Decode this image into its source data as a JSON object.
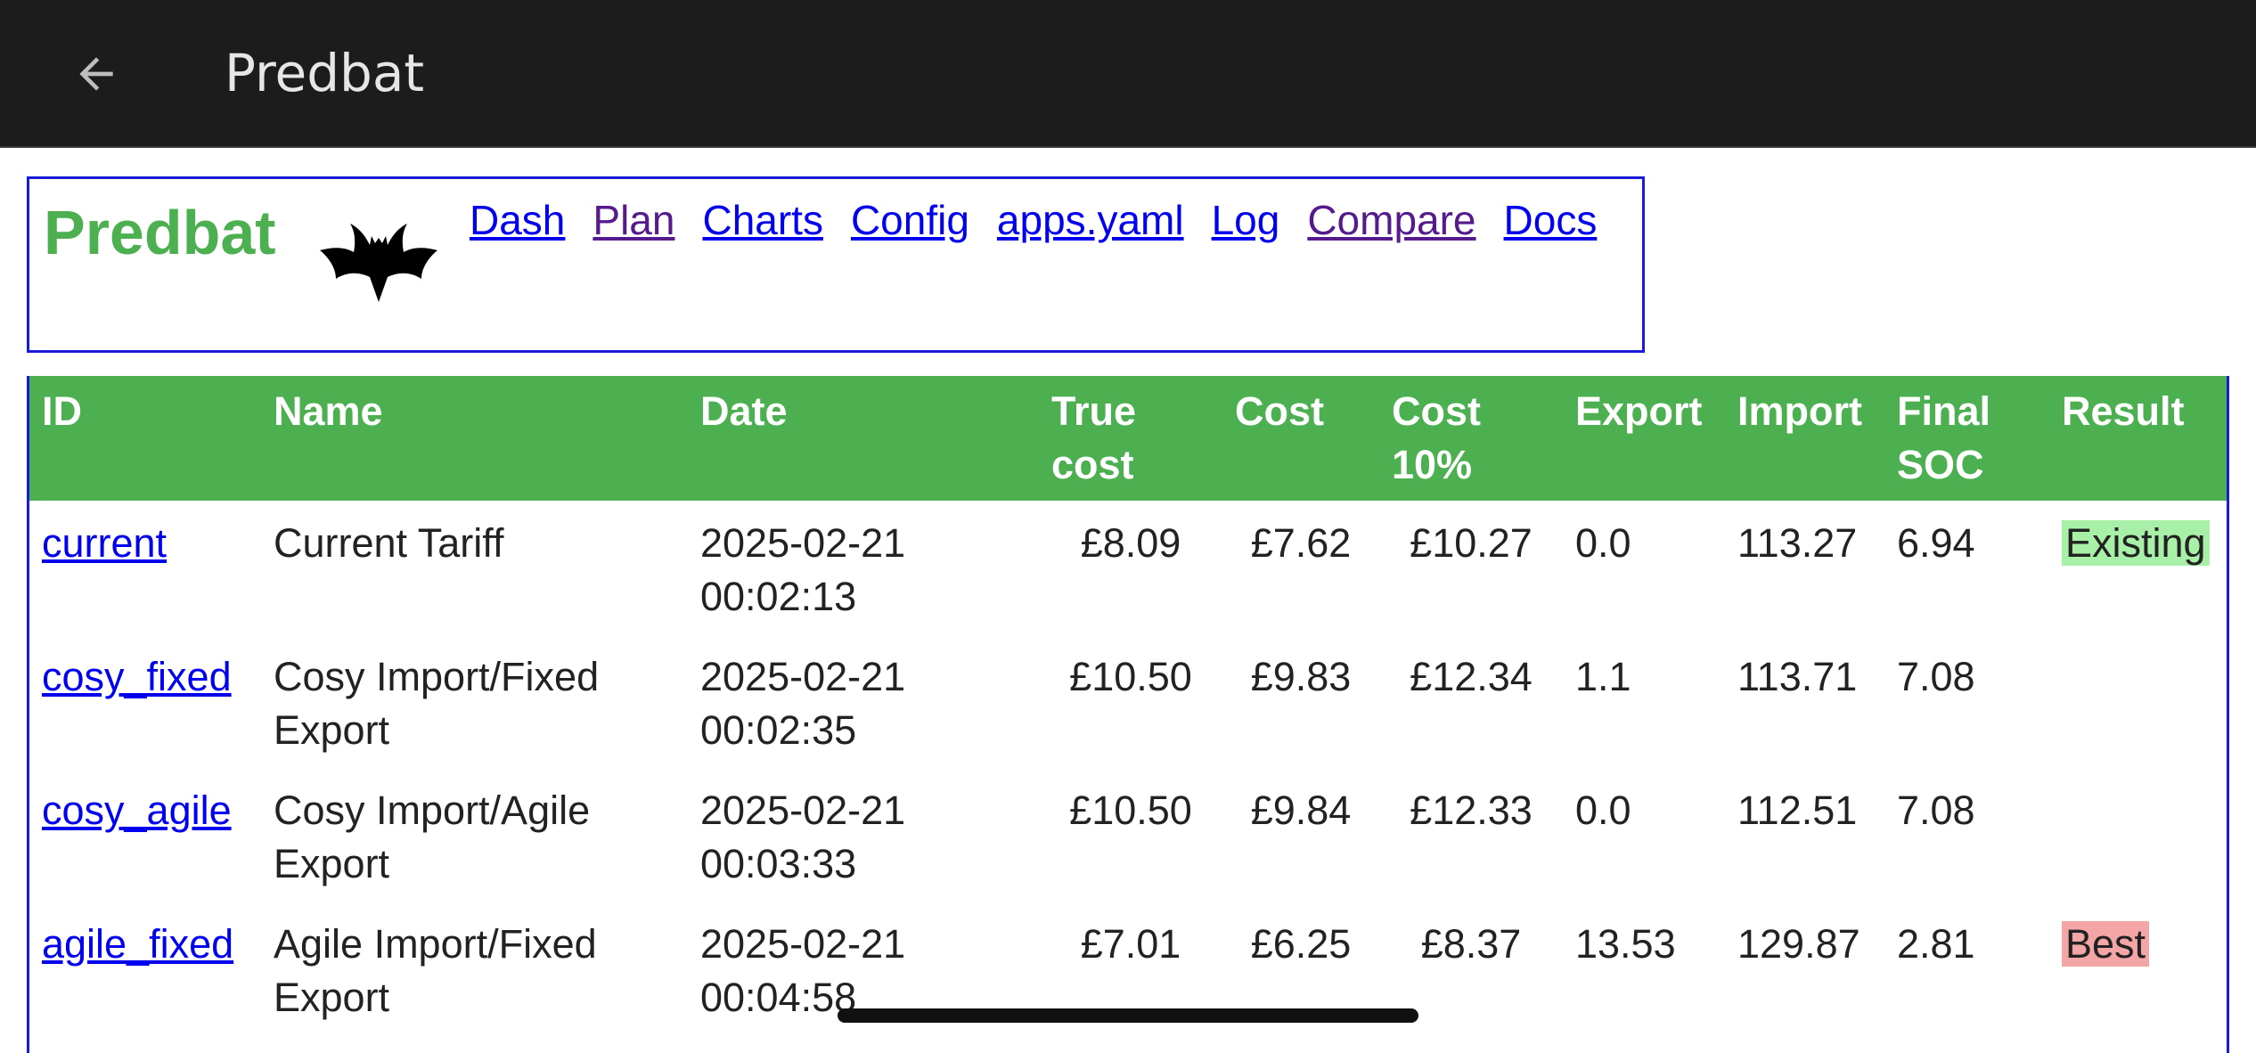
{
  "appbar": {
    "title": "Predbat",
    "back_icon": "arrow-left-icon"
  },
  "header": {
    "brand": "Predbat",
    "logo_icon": "bat-icon",
    "nav": [
      {
        "label": "Dash",
        "visited": false
      },
      {
        "label": "Plan",
        "visited": true
      },
      {
        "label": "Charts",
        "visited": false
      },
      {
        "label": "Config",
        "visited": false
      },
      {
        "label": "apps.yaml",
        "visited": false
      },
      {
        "label": "Log",
        "visited": false
      },
      {
        "label": "Compare",
        "visited": true
      },
      {
        "label": "Docs",
        "visited": false
      }
    ]
  },
  "table": {
    "columns": [
      {
        "key": "id",
        "line1": "ID",
        "line2": ""
      },
      {
        "key": "name",
        "line1": "Name",
        "line2": ""
      },
      {
        "key": "date",
        "line1": "Date",
        "line2": ""
      },
      {
        "key": "true_cost",
        "line1": "True",
        "line2": "cost"
      },
      {
        "key": "cost",
        "line1": "Cost",
        "line2": ""
      },
      {
        "key": "cost10",
        "line1": "Cost",
        "line2": "10%"
      },
      {
        "key": "export",
        "line1": "Export",
        "line2": ""
      },
      {
        "key": "import",
        "line1": "Import",
        "line2": ""
      },
      {
        "key": "final_soc",
        "line1": "Final",
        "line2": "SOC"
      },
      {
        "key": "result",
        "line1": "Result",
        "line2": ""
      }
    ],
    "rows": [
      {
        "id": "current",
        "name_line1": "Current Tariff",
        "name_line2": "",
        "date": "2025-02-21",
        "time": "00:02:13",
        "true_cost": "£8.09",
        "cost": "£7.62",
        "cost10": "£10.27",
        "export": "0.0",
        "import": "113.27",
        "final_soc": "6.94",
        "result": "Existing",
        "result_type": "existing"
      },
      {
        "id": "cosy_fixed",
        "name_line1": "Cosy Import/Fixed",
        "name_line2": "Export",
        "date": "2025-02-21",
        "time": "00:02:35",
        "true_cost": "£10.50",
        "cost": "£9.83",
        "cost10": "£12.34",
        "export": "1.1",
        "import": "113.71",
        "final_soc": "7.08",
        "result": "",
        "result_type": ""
      },
      {
        "id": "cosy_agile",
        "name_line1": "Cosy Import/Agile",
        "name_line2": "Export",
        "date": "2025-02-21",
        "time": "00:03:33",
        "true_cost": "£10.50",
        "cost": "£9.84",
        "cost10": "£12.33",
        "export": "0.0",
        "import": "112.51",
        "final_soc": "7.08",
        "result": "",
        "result_type": ""
      },
      {
        "id": "agile_fixed",
        "name_line1": "Agile Import/Fixed",
        "name_line2": "Export",
        "date": "2025-02-21",
        "time": "00:04:58",
        "true_cost": "£7.01",
        "cost": "£6.25",
        "cost10": "£8.37",
        "export": "13.53",
        "import": "129.87",
        "final_soc": "2.81",
        "result": "Best",
        "result_type": "best"
      }
    ]
  },
  "colors": {
    "appbar_bg": "#1c1c1c",
    "brand_green": "#4caf50",
    "header_green": "#4caf50",
    "border_blue": "#1a1adb",
    "link_blue": "#0000ee",
    "link_visited": "#551a8b",
    "existing_bg": "#a8f0a8",
    "best_bg": "#f4a6a6"
  }
}
